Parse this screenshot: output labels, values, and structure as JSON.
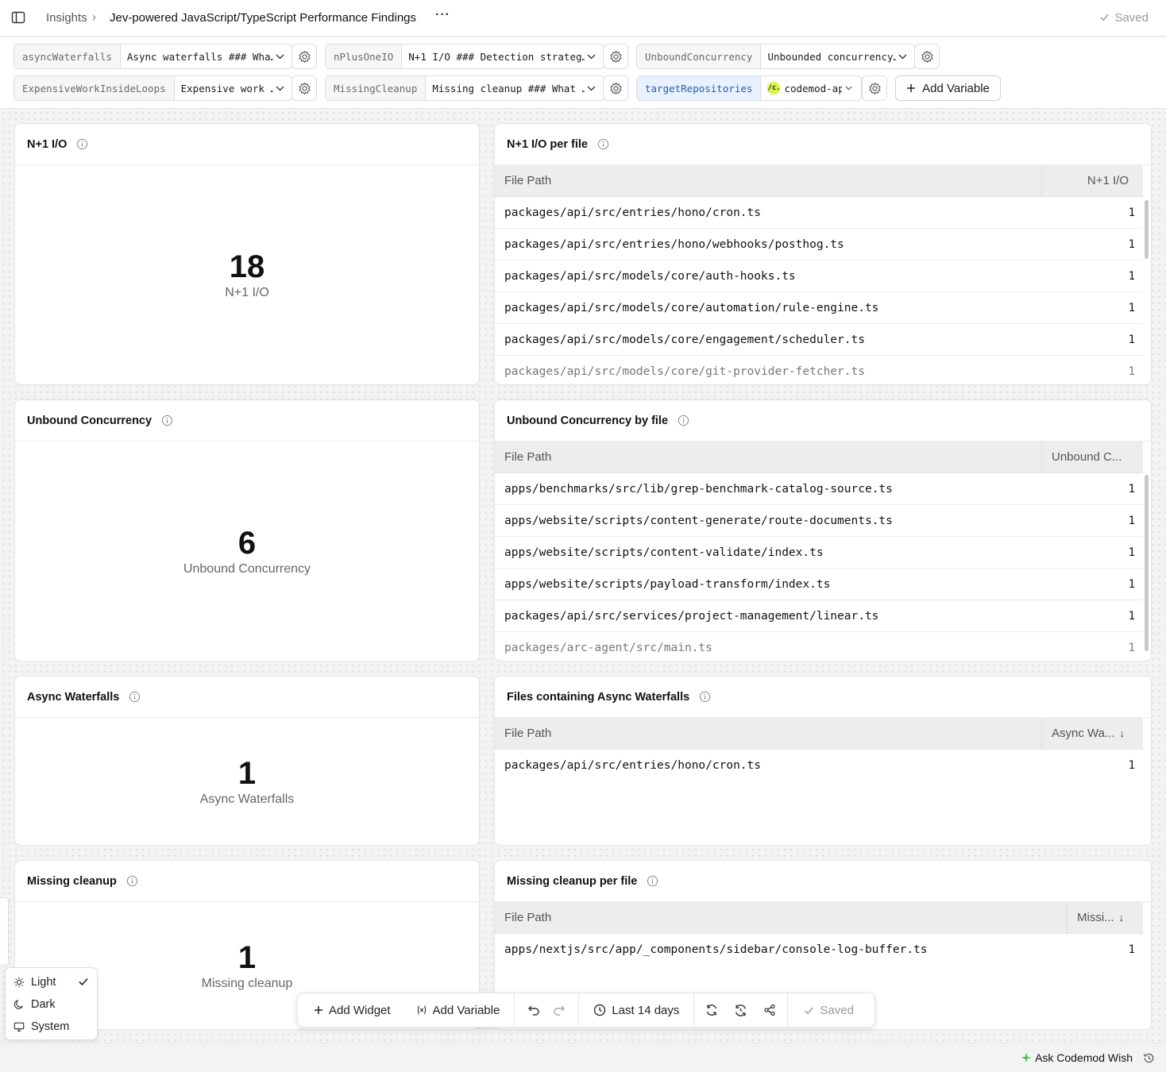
{
  "header": {
    "breadcrumb_root": "Insights",
    "breadcrumb_sep": "›",
    "title": "Jev-powered JavaScript/TypeScript Performance Findings",
    "more": "···",
    "saved": "Saved"
  },
  "variables": [
    {
      "name": "asyncWaterfalls",
      "value": "Async waterfalls ### Wha…"
    },
    {
      "name": "nPlusOneIO",
      "value": "N+1 I/O ### Detection strateg…"
    },
    {
      "name": "UnboundConcurrency",
      "value": "Unbounded concurrency…"
    },
    {
      "name": "ExpensiveWorkInsideLoops",
      "value": "Expensive work …"
    },
    {
      "name": "MissingCleanup",
      "value": "Missing cleanup ### What …"
    },
    {
      "name": "targetRepositories",
      "value": "codemod-app",
      "logo": "/c."
    }
  ],
  "add_variable_label": "Add Variable",
  "widgets": {
    "n1_stat": {
      "title": "N+1 I/O",
      "value": "18",
      "label": "N+1 I/O"
    },
    "unbound_stat": {
      "title": "Unbound Concurrency",
      "value": "6",
      "label": "Unbound Concurrency"
    },
    "async_stat": {
      "title": "Async Waterfalls",
      "value": "1",
      "label": "Async Waterfalls"
    },
    "cleanup_stat": {
      "title": "Missing cleanup",
      "value": "1",
      "label": "Missing cleanup"
    },
    "n1_table": {
      "title": "N+1 I/O per file",
      "col_path": "File Path",
      "col_value": "N+1 I/O",
      "rows": [
        {
          "path": "packages/api/src/entries/hono/cron.ts",
          "value": "1"
        },
        {
          "path": "packages/api/src/entries/hono/webhooks/posthog.ts",
          "value": "1"
        },
        {
          "path": "packages/api/src/models/core/auth-hooks.ts",
          "value": "1"
        },
        {
          "path": "packages/api/src/models/core/automation/rule-engine.ts",
          "value": "1"
        },
        {
          "path": "packages/api/src/models/core/engagement/scheduler.ts",
          "value": "1"
        },
        {
          "path": "packages/api/src/models/core/git-provider-fetcher.ts",
          "value": "1"
        }
      ]
    },
    "unbound_table": {
      "title": "Unbound Concurrency by file",
      "col_path": "File Path",
      "col_value": "Unbound C...",
      "rows": [
        {
          "path": "apps/benchmarks/src/lib/grep-benchmark-catalog-source.ts",
          "value": "1"
        },
        {
          "path": "apps/website/scripts/content-generate/route-documents.ts",
          "value": "1"
        },
        {
          "path": "apps/website/scripts/content-validate/index.ts",
          "value": "1"
        },
        {
          "path": "apps/website/scripts/payload-transform/index.ts",
          "value": "1"
        },
        {
          "path": "packages/api/src/services/project-management/linear.ts",
          "value": "1"
        },
        {
          "path": "packages/arc-agent/src/main.ts",
          "value": "1"
        }
      ]
    },
    "async_table": {
      "title": "Files containing Async Waterfalls",
      "col_path": "File Path",
      "col_value": "Async Wa...",
      "sort": "↓",
      "rows": [
        {
          "path": "packages/api/src/entries/hono/cron.ts",
          "value": "1"
        }
      ]
    },
    "cleanup_table": {
      "title": "Missing cleanup per file",
      "col_path": "File Path",
      "col_value": "Missi...",
      "sort": "↓",
      "rows": [
        {
          "path": "apps/nextjs/src/app/_components/sidebar/console-log-buffer.ts",
          "value": "1"
        }
      ]
    }
  },
  "toolbar": {
    "add_widget": "Add Widget",
    "add_variable": "Add Variable",
    "time_range": "Last 14 days",
    "saved": "Saved"
  },
  "theme_menu": {
    "light": "Light",
    "dark": "Dark",
    "system": "System",
    "selected": "light"
  },
  "footer": {
    "ask": "Ask Codemod Wish"
  },
  "colors": {
    "accent_var_bg": "#e8f1ff",
    "accent_var_text": "#2a5db0",
    "ask_star": "#3fbf3f",
    "repo_logo": "#d6f54a"
  }
}
